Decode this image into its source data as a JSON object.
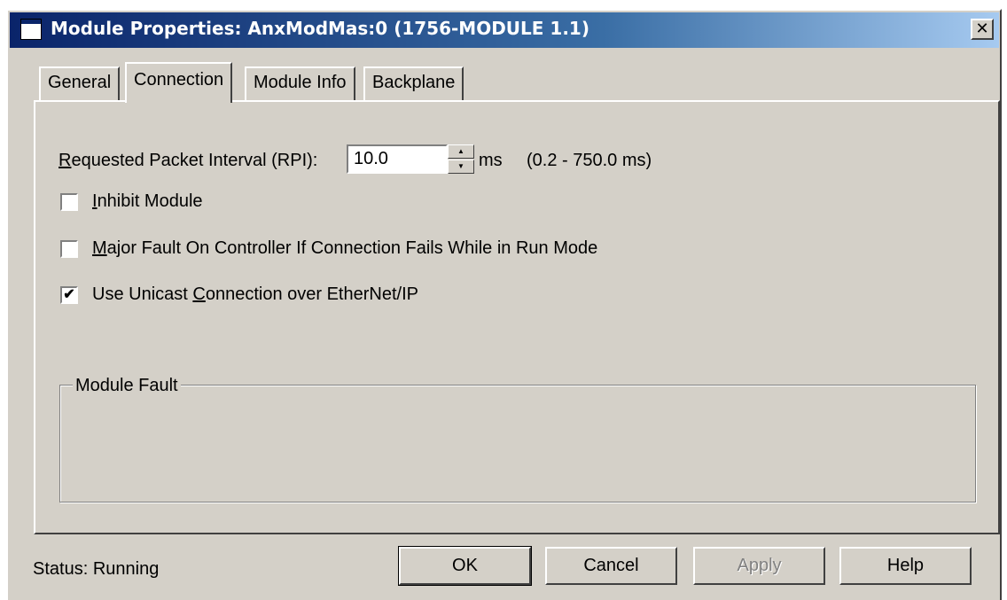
{
  "window": {
    "title": "Module Properties: AnxModMas:0 (1756-MODULE 1.1)",
    "close_glyph": "✕",
    "icon": "window-icon"
  },
  "tabs": [
    {
      "label": "General",
      "active": false
    },
    {
      "label": "Connection",
      "active": true
    },
    {
      "label": "Module Info",
      "active": false
    },
    {
      "label": "Backplane",
      "active": false
    }
  ],
  "connection": {
    "rpi_label_ul": "R",
    "rpi_label_rest": "equested Packet Interval (RPI):",
    "rpi_value": "10.0",
    "rpi_unit": "ms",
    "rpi_range": "(0.2 - 750.0 ms)",
    "inhibit": {
      "ul": "I",
      "rest": "nhibit Module",
      "checked": false
    },
    "major_fault": {
      "ul": "M",
      "rest": "ajor Fault On Controller If Connection Fails While in Run Mode",
      "checked": false
    },
    "unicast": {
      "pre": "Use Unicast ",
      "ul": "C",
      "rest": "onnection over EtherNet/IP",
      "checked": true
    }
  },
  "module_fault": {
    "legend": "Module Fault",
    "text": ""
  },
  "status": {
    "text": "Status:  Running"
  },
  "buttons": {
    "ok": "OK",
    "cancel": "Cancel",
    "apply": "Apply",
    "help": "Help"
  },
  "colors": {
    "face": "#d4d0c8",
    "title_start": "#0a246a",
    "title_end": "#a6caf0",
    "disabled_text": "#808080"
  }
}
